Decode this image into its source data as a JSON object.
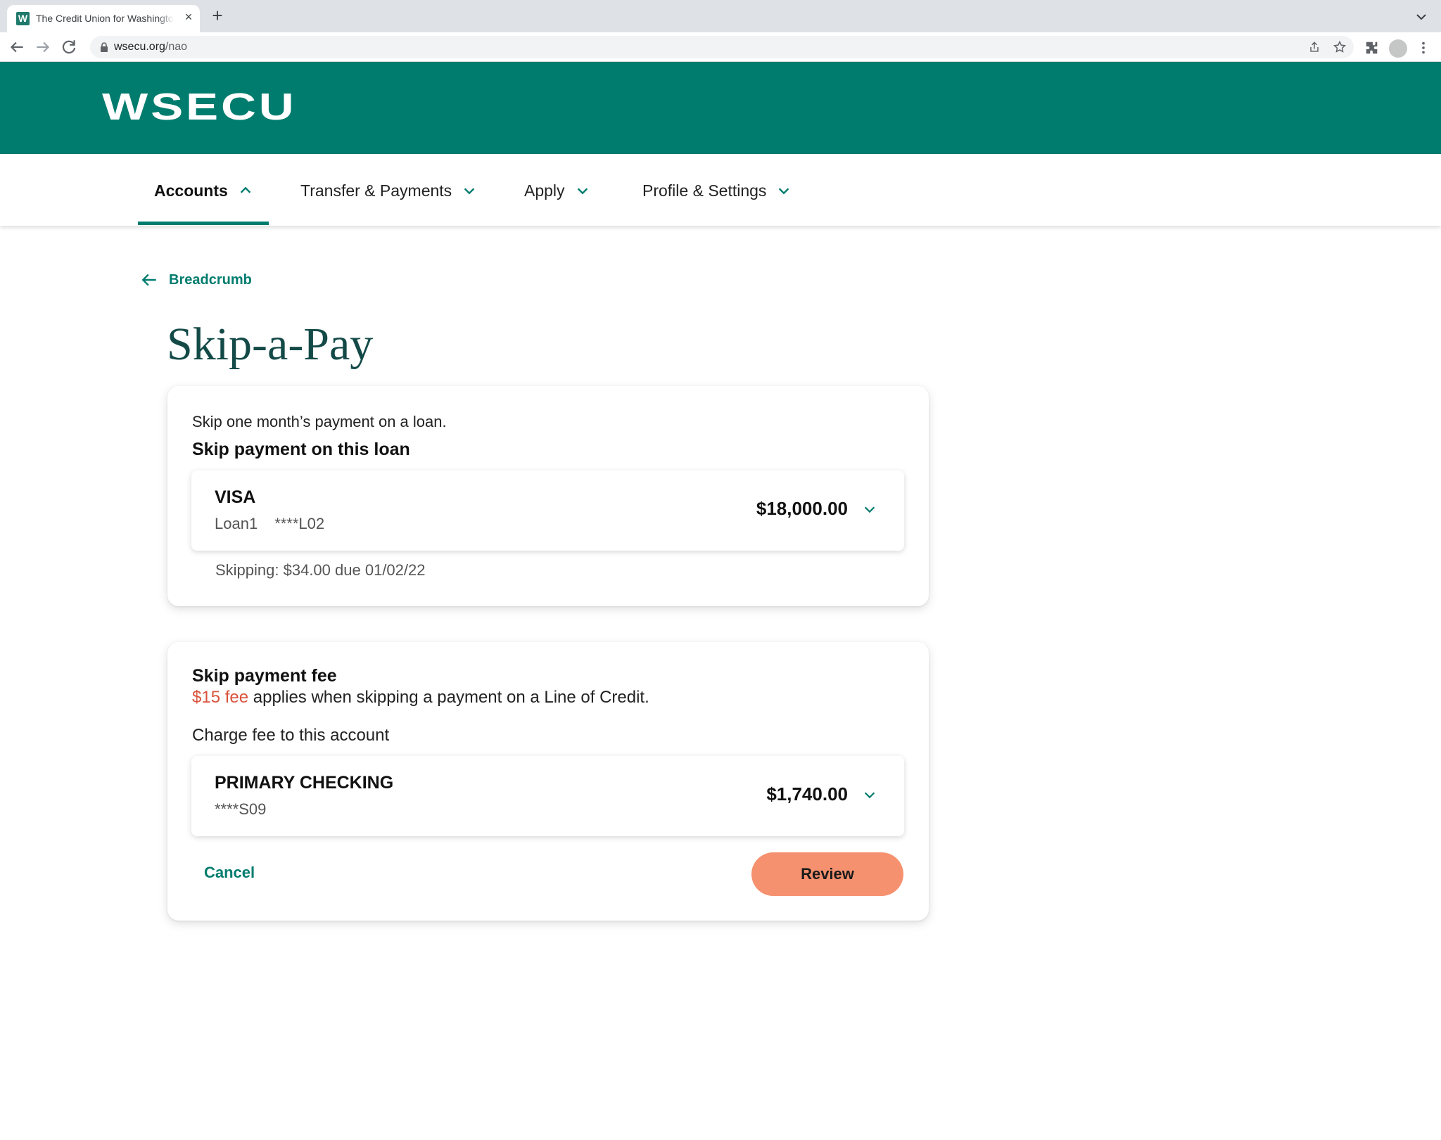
{
  "browser": {
    "tab_title": "The Credit Union for Washington",
    "favicon_letter": "W",
    "tab_close": "×",
    "new_tab": "+",
    "url_host": "wsecu.org",
    "url_path": "/nao"
  },
  "site": {
    "logo": "WSECU",
    "brand_color": "#007c6e",
    "accent_color": "#f6916f"
  },
  "nav": {
    "items": [
      {
        "label": "Accounts",
        "active": true,
        "icon": "chevron-up-icon"
      },
      {
        "label": "Transfer & Payments",
        "active": false,
        "icon": "chevron-down-icon"
      },
      {
        "label": "Apply",
        "active": false,
        "icon": "chevron-down-icon"
      },
      {
        "label": "Profile & Settings",
        "active": false,
        "icon": "chevron-down-icon"
      }
    ]
  },
  "breadcrumb": {
    "label": "Breadcrumb",
    "icon": "arrow-left-icon"
  },
  "page": {
    "title": "Skip-a-Pay"
  },
  "loan_card": {
    "intro": "Skip one month’s payment on a loan.",
    "title": "Skip payment on this loan",
    "account": {
      "name": "VISA",
      "nickname": "Loan1",
      "number": "****L02",
      "balance": "$18,000.00"
    },
    "skipping": "Skipping: $34.00 due 01/02/22"
  },
  "fee_card": {
    "title": "Skip payment fee",
    "fee_amount": "$15 fee",
    "fee_text": " applies when skipping a payment on a Line of Credit.",
    "charge_label": "Charge fee to this account",
    "account": {
      "name": "PRIMARY CHECKING",
      "number": "****S09",
      "balance": "$1,740.00"
    },
    "cancel_label": "Cancel",
    "review_label": "Review"
  }
}
